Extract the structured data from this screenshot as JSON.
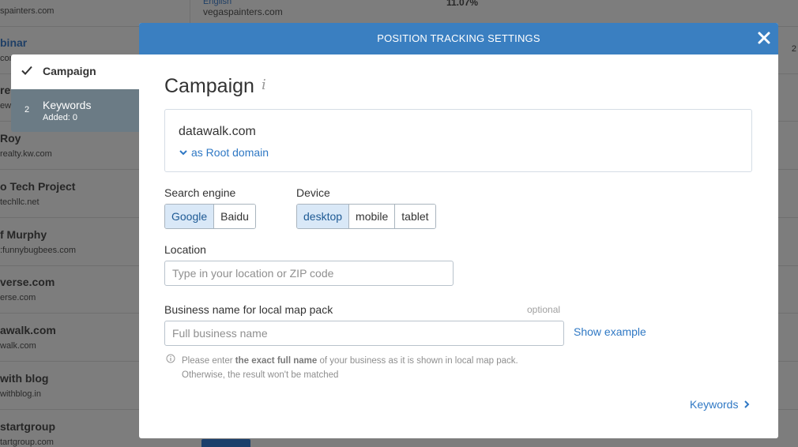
{
  "background": {
    "table_top": {
      "engine": "English",
      "site": "vegaspainters.com",
      "percent": "11.07%"
    },
    "rows": [
      {
        "name": "",
        "domain": "spainters.com"
      },
      {
        "name": "binar",
        "domain": "com"
      },
      {
        "name": "re",
        "domain": "ew"
      },
      {
        "name": "Roy",
        "domain": "realty.kw.com"
      },
      {
        "name": "o Tech Project",
        "domain": "techllc.net"
      },
      {
        "name": "f Murphy",
        "domain": ":funnybugbees.com"
      },
      {
        "name": "verse.com",
        "domain": "erse.com"
      },
      {
        "name": "awalk.com",
        "domain": "walk.com"
      },
      {
        "name": "with blog",
        "domain": "withblog.in"
      },
      {
        "name": "startgroup",
        "domain": "tartgroup.com"
      }
    ],
    "right_edge_number": "2"
  },
  "stepper": {
    "step1_label": "Campaign",
    "step2_number": "2",
    "step2_label": "Keywords",
    "step2_sub": "Added: 0"
  },
  "modal": {
    "title": "POSITION TRACKING SETTINGS",
    "section_title": "Campaign",
    "info_glyph": "i",
    "domain": "datawalk.com",
    "domain_scope": "as Root domain",
    "search_engine_label": "Search engine",
    "search_engines": [
      "Google",
      "Baidu"
    ],
    "search_engine_selected": "Google",
    "device_label": "Device",
    "devices": [
      "desktop",
      "mobile",
      "tablet"
    ],
    "device_selected": "desktop",
    "location_label": "Location",
    "location_placeholder": "Type in your location or ZIP code",
    "location_value": "",
    "business_label": "Business name for local map pack",
    "business_optional": "optional",
    "business_placeholder": "Full business name",
    "business_value": "",
    "show_example": "Show example",
    "hint_pre": "Please enter ",
    "hint_bold": "the exact full name",
    "hint_post": " of your business as it is shown in local map pack.",
    "hint_line2": "Otherwise, the result won't be matched",
    "next_label": "Keywords"
  },
  "colors": {
    "header_blue": "#3a7fc1",
    "link_blue": "#2f78c4",
    "selected_bg": "#d9e8f7"
  },
  "icons": {
    "close": "close-icon",
    "check": "checkmark-icon",
    "scope": "chevron-down-icon",
    "hint": "info-circle-icon",
    "next": "chevron-right-icon"
  }
}
